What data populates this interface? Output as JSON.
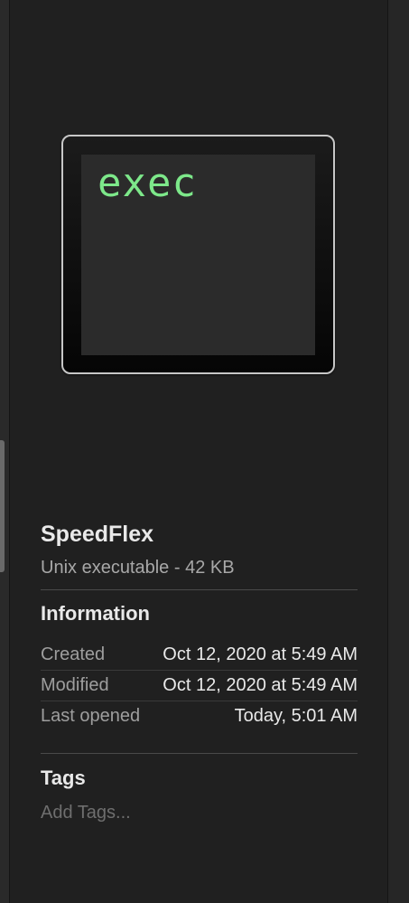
{
  "preview": {
    "terminal_text": "exec"
  },
  "file": {
    "name": "SpeedFlex",
    "kind": "Unix executable - 42 KB"
  },
  "information": {
    "title": "Information",
    "rows": [
      {
        "label": "Created",
        "value": "Oct 12, 2020 at 5:49 AM"
      },
      {
        "label": "Modified",
        "value": "Oct 12, 2020 at 5:49 AM"
      },
      {
        "label": "Last opened",
        "value": "Today, 5:01 AM"
      }
    ]
  },
  "tags": {
    "title": "Tags",
    "placeholder": "Add Tags..."
  },
  "colors": {
    "background": "#202020",
    "terminal_text": "#7de88a",
    "primary_text": "#e9e9e9",
    "secondary_text": "#a8a8a8"
  },
  "icons": {
    "preview": "terminal-exec-icon"
  }
}
